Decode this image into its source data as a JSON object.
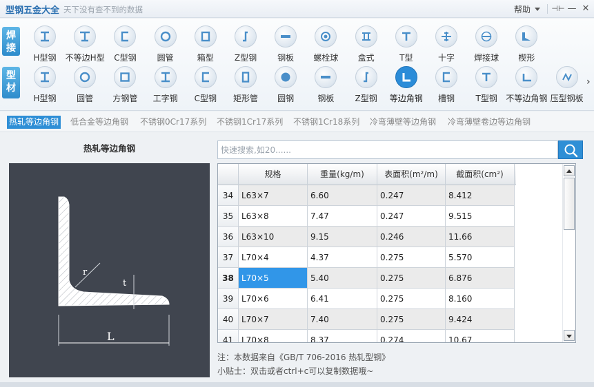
{
  "app": {
    "title": "型钢五金大全",
    "subtitle": "天下没有查不到的数据",
    "help_label": "帮助",
    "pin_glyph": "⊣⊢",
    "minimize_glyph": "—",
    "close_glyph": "✕"
  },
  "categories": {
    "weld": {
      "label_line1": "焊",
      "label_line2": "接",
      "items": [
        {
          "label": "H型钢",
          "icon": "h-beam-icon"
        },
        {
          "label": "不等边H型",
          "icon": "unequal-h-icon"
        },
        {
          "label": "C型钢",
          "icon": "c-channel-icon"
        },
        {
          "label": "圆管",
          "icon": "round-tube-icon"
        },
        {
          "label": "箱型",
          "icon": "box-section-icon"
        },
        {
          "label": "Z型钢",
          "icon": "z-section-icon"
        },
        {
          "label": "钢板",
          "icon": "steel-plate-icon"
        },
        {
          "label": "螺栓球",
          "icon": "bolt-ball-icon"
        },
        {
          "label": "盒式",
          "icon": "box-type-icon"
        },
        {
          "label": "T型",
          "icon": "t-section-icon"
        },
        {
          "label": "十字",
          "icon": "cross-section-icon"
        },
        {
          "label": "焊接球",
          "icon": "welded-ball-icon"
        },
        {
          "label": "楔形",
          "icon": "wedge-icon"
        }
      ]
    },
    "profile": {
      "label_line1": "型",
      "label_line2": "材",
      "items": [
        {
          "label": "H型钢",
          "icon": "h-beam-icon"
        },
        {
          "label": "圆管",
          "icon": "round-tube-icon"
        },
        {
          "label": "方钢管",
          "icon": "square-tube-icon"
        },
        {
          "label": "工字钢",
          "icon": "i-beam-icon"
        },
        {
          "label": "C型钢",
          "icon": "c-channel-icon"
        },
        {
          "label": "矩形管",
          "icon": "rect-tube-icon"
        },
        {
          "label": "圆钢",
          "icon": "round-bar-icon"
        },
        {
          "label": "钢板",
          "icon": "steel-plate-icon"
        },
        {
          "label": "Z型钢",
          "icon": "z-section-icon"
        },
        {
          "label": "等边角钢",
          "icon": "equal-angle-icon",
          "selected": true
        },
        {
          "label": "槽钢",
          "icon": "channel-icon"
        },
        {
          "label": "T型钢",
          "icon": "t-section-icon"
        },
        {
          "label": "不等边角钢",
          "icon": "unequal-angle-icon"
        },
        {
          "label": "压型钢板",
          "icon": "profiled-sheet-icon"
        }
      ],
      "next_glyph": "›"
    }
  },
  "subtabs": [
    {
      "label": "热轧等边角钢",
      "active": true
    },
    {
      "label": "低合金等边角钢"
    },
    {
      "label": "不锈钢0Cr17系列"
    },
    {
      "label": "不锈钢1Cr17系列"
    },
    {
      "label": "不锈钢1Cr18系列"
    },
    {
      "label": "冷弯薄壁等边角钢"
    },
    {
      "label": "冷弯薄壁卷边等边角钢"
    }
  ],
  "diagram": {
    "title": "热轧等边角钢",
    "label_r": "r",
    "label_t": "t",
    "label_L": "L"
  },
  "search": {
    "placeholder": "快速搜索,如20......",
    "value": ""
  },
  "table": {
    "columns": [
      "",
      "规格",
      "重量(kg/m)",
      "表面积(m²/m)",
      "截面积(cm²)"
    ],
    "rows": [
      {
        "idx": "34",
        "spec": "L63×7",
        "weight": "6.60",
        "surface": "0.247",
        "area": "8.412"
      },
      {
        "idx": "35",
        "spec": "L63×8",
        "weight": "7.47",
        "surface": "0.247",
        "area": "9.515"
      },
      {
        "idx": "36",
        "spec": "L63×10",
        "weight": "9.15",
        "surface": "0.246",
        "area": "11.66"
      },
      {
        "idx": "37",
        "spec": "L70×4",
        "weight": "4.37",
        "surface": "0.275",
        "area": "5.570"
      },
      {
        "idx": "38",
        "spec": "L70×5",
        "weight": "5.40",
        "surface": "0.275",
        "area": "6.876",
        "current": true
      },
      {
        "idx": "39",
        "spec": "L70×6",
        "weight": "6.41",
        "surface": "0.275",
        "area": "8.160"
      },
      {
        "idx": "40",
        "spec": "L70×7",
        "weight": "7.40",
        "surface": "0.275",
        "area": "9.424"
      },
      {
        "idx": "41",
        "spec": "L70×8",
        "weight": "8.37",
        "surface": "0.274",
        "area": "10.67"
      }
    ]
  },
  "notes": {
    "source": "注：本数据来自《GB/T 706-2016  热轧型钢》",
    "tip": "小贴士：双击或者ctrl+c可以复制数据哦~"
  },
  "colors": {
    "accent": "#2f8fd6",
    "selection": "#3196e8",
    "diagram_bg": "#40454f"
  }
}
